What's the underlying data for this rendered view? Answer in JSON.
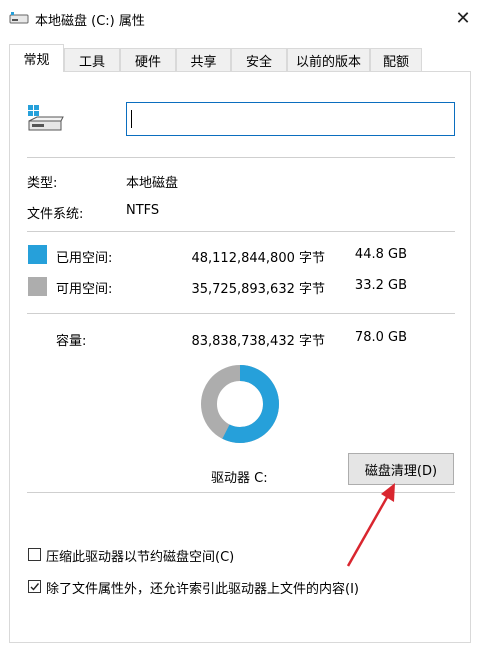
{
  "window": {
    "title": "本地磁盘 (C:) 属性",
    "close_glyph": "✕"
  },
  "tabs": [
    {
      "label": "常规",
      "active": true
    },
    {
      "label": "工具"
    },
    {
      "label": "硬件"
    },
    {
      "label": "共享"
    },
    {
      "label": "安全"
    },
    {
      "label": "以前的版本"
    },
    {
      "label": "配额"
    }
  ],
  "general": {
    "name_value": "",
    "type_label": "类型:",
    "type_value": "本地磁盘",
    "fs_label": "文件系统:",
    "fs_value": "NTFS"
  },
  "space": {
    "used_label": "已用空间:",
    "used_bytes": "48,112,844,800 字节",
    "used_gb": "44.8 GB",
    "free_label": "可用空间:",
    "free_bytes": "35,725,893,632 字节",
    "free_gb": "33.2 GB",
    "capacity_label": "容量:",
    "capacity_bytes": "83,838,738,432 字节",
    "capacity_gb": "78.0 GB",
    "used_fraction": 0.574,
    "used_color": "#26a0da",
    "free_color": "#adadad"
  },
  "drive": {
    "label": "驱动器 C:",
    "cleanup_button": "磁盘清理(D)"
  },
  "options": {
    "compress_label": "压缩此驱动器以节约磁盘空间(C)",
    "compress_checked": false,
    "index_label": "除了文件属性外，还允许索引此驱动器上文件的内容(I)",
    "index_checked": true
  },
  "annotation": {
    "arrow_color": "#d9262f"
  }
}
